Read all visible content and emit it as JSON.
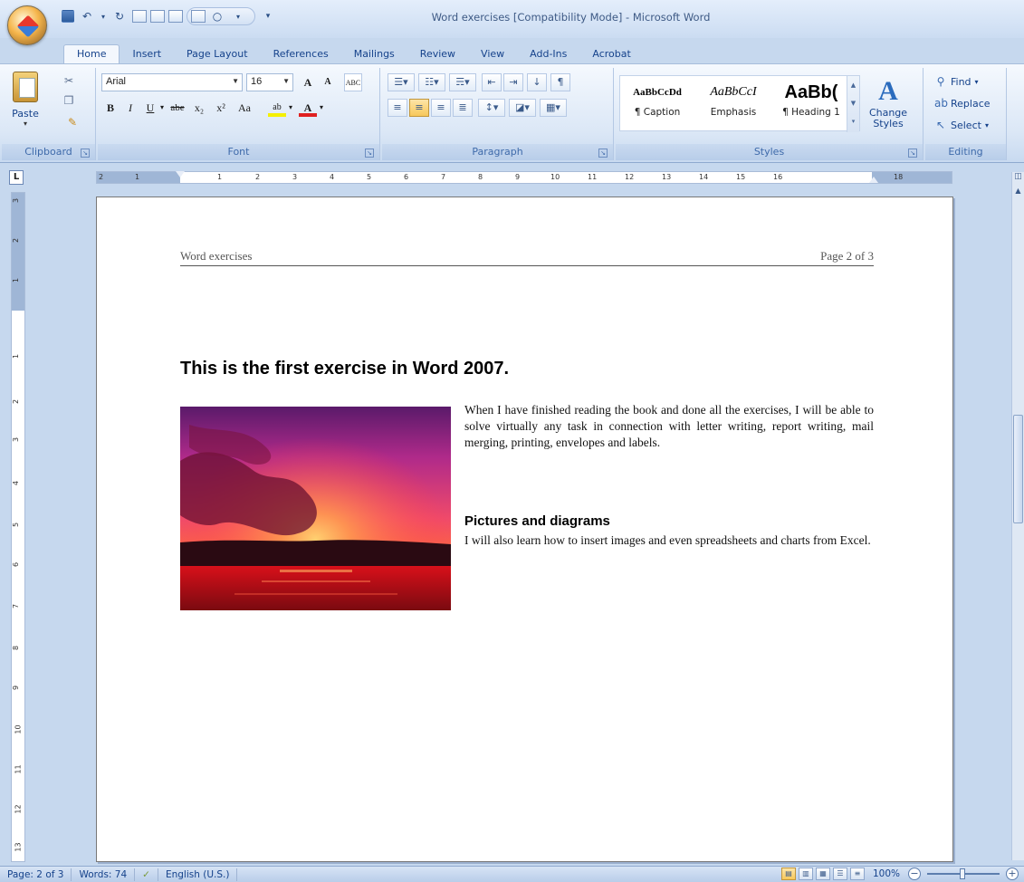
{
  "window": {
    "title": "Word exercises [Compatibility Mode] - Microsoft Word"
  },
  "tabs": [
    {
      "label": "Home",
      "active": true
    },
    {
      "label": "Insert"
    },
    {
      "label": "Page Layout"
    },
    {
      "label": "References"
    },
    {
      "label": "Mailings"
    },
    {
      "label": "Review"
    },
    {
      "label": "View"
    },
    {
      "label": "Add-Ins"
    },
    {
      "label": "Acrobat"
    }
  ],
  "ribbon": {
    "clipboard": {
      "paste": "Paste",
      "label": "Clipboard"
    },
    "font": {
      "name": "Arial",
      "size": "16",
      "label": "Font",
      "grow": "A",
      "shrink": "A",
      "clear": "ABC",
      "bold": "B",
      "italic": "I",
      "underline": "U",
      "strike": "abe",
      "subscript": "x₂",
      "superscript": "x²",
      "case": "Aa",
      "highlight": "ab",
      "color": "A"
    },
    "paragraph": {
      "label": "Paragraph"
    },
    "styles": {
      "label": "Styles",
      "items": [
        {
          "preview": "AaBbCcDd",
          "name": "¶ Caption"
        },
        {
          "preview": "AaBbCcI",
          "name": "Emphasis"
        },
        {
          "preview": "AaBb(",
          "name": "¶ Heading 1"
        }
      ],
      "change": "Change Styles"
    },
    "editing": {
      "label": "Editing",
      "find": "Find",
      "replace": "Replace",
      "select": "Select"
    }
  },
  "ruler": {
    "h_ticks": [
      "2",
      "1",
      "1",
      "2",
      "3",
      "4",
      "5",
      "6",
      "7",
      "8",
      "9",
      "10",
      "11",
      "12",
      "13",
      "14",
      "15",
      "16",
      "18"
    ],
    "v_ticks": [
      "3",
      "2",
      "1",
      "1",
      "2",
      "3",
      "4",
      "5",
      "6",
      "7",
      "8",
      "9",
      "10",
      "11",
      "12",
      "13"
    ]
  },
  "document": {
    "header_left": "Word exercises",
    "header_right": "Page 2 of 3",
    "title": "This is the first  exercise in Word 2007.",
    "paragraph1": "When I have finished reading the book and done all the exercises, I will be able to solve virtually any task in connection with letter writing, report writing, mail merging, printing, envelopes and labels.",
    "subheading": "Pictures and diagrams",
    "paragraph2": "I will also learn how to insert images and even spreadsheets and charts from Excel."
  },
  "statusbar": {
    "page": "Page: 2 of 3",
    "words": "Words: 74",
    "language": "English (U.S.)",
    "zoom": "100%"
  }
}
